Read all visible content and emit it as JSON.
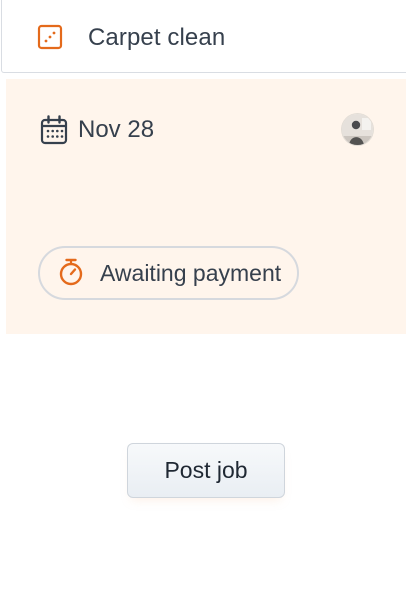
{
  "job": {
    "service_title": "Carpet clean",
    "service_icon": "carpet-icon",
    "date": "Nov 28",
    "date_icon": "calendar-icon",
    "status": "Awaiting payment",
    "status_icon": "timer-icon"
  },
  "actions": {
    "post_job_label": "Post job"
  },
  "colors": {
    "accent": "#e46a1b",
    "panel_background": "#fff5ec",
    "text": "#36404d",
    "border": "#d6d9de"
  }
}
